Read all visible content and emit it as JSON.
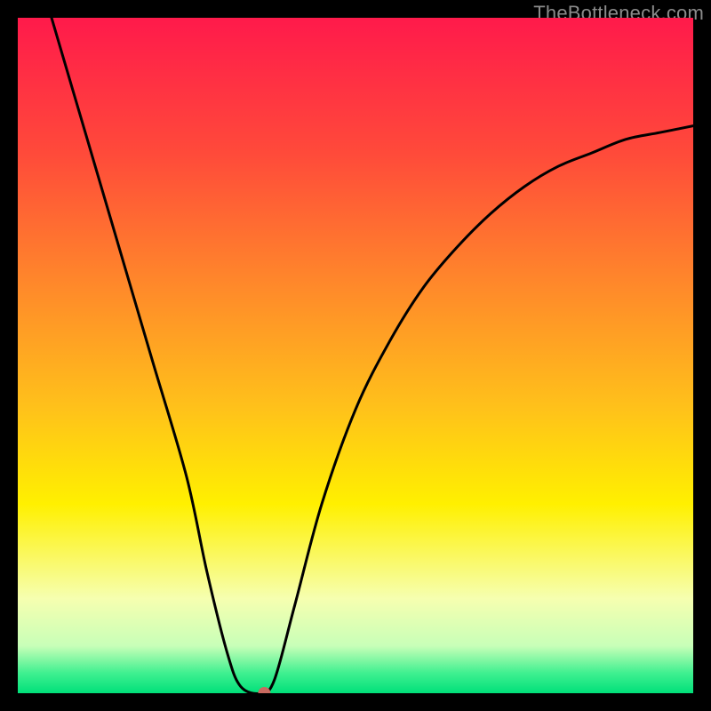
{
  "watermark": "TheBottleneck.com",
  "chart_data": {
    "type": "line",
    "title": "",
    "xlabel": "",
    "ylabel": "",
    "xlim": [
      0,
      100
    ],
    "ylim": [
      0,
      100
    ],
    "gradient_stops": [
      {
        "pos": 0.0,
        "color": "#ff1a4b"
      },
      {
        "pos": 0.2,
        "color": "#ff4a3a"
      },
      {
        "pos": 0.4,
        "color": "#ff8a2a"
      },
      {
        "pos": 0.58,
        "color": "#ffc21a"
      },
      {
        "pos": 0.72,
        "color": "#fff000"
      },
      {
        "pos": 0.86,
        "color": "#f6ffb0"
      },
      {
        "pos": 0.93,
        "color": "#c8ffb8"
      },
      {
        "pos": 0.97,
        "color": "#40f090"
      },
      {
        "pos": 1.0,
        "color": "#00e07a"
      }
    ],
    "series": [
      {
        "name": "bottleneck-curve",
        "points": [
          {
            "x": 5,
            "y": 100
          },
          {
            "x": 10,
            "y": 83
          },
          {
            "x": 15,
            "y": 66
          },
          {
            "x": 20,
            "y": 49
          },
          {
            "x": 25,
            "y": 32
          },
          {
            "x": 28,
            "y": 18
          },
          {
            "x": 31,
            "y": 6
          },
          {
            "x": 33,
            "y": 1
          },
          {
            "x": 36,
            "y": 0
          },
          {
            "x": 38,
            "y": 2
          },
          {
            "x": 41,
            "y": 13
          },
          {
            "x": 45,
            "y": 28
          },
          {
            "x": 50,
            "y": 42
          },
          {
            "x": 55,
            "y": 52
          },
          {
            "x": 60,
            "y": 60
          },
          {
            "x": 65,
            "y": 66
          },
          {
            "x": 70,
            "y": 71
          },
          {
            "x": 75,
            "y": 75
          },
          {
            "x": 80,
            "y": 78
          },
          {
            "x": 85,
            "y": 80
          },
          {
            "x": 90,
            "y": 82
          },
          {
            "x": 95,
            "y": 83
          },
          {
            "x": 100,
            "y": 84
          }
        ]
      }
    ],
    "marker": {
      "x": 36.5,
      "y": 0,
      "color": "#c96a60"
    }
  }
}
